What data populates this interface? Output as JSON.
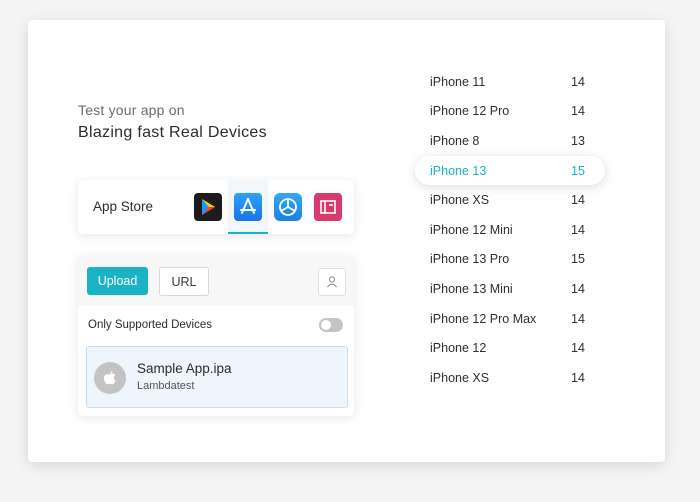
{
  "intro": {
    "line1": "Test your app on",
    "line2": "Blazing fast Real Devices"
  },
  "store_bar": {
    "label": "App Store",
    "icons": [
      "google-play-icon",
      "app-store-icon",
      "testflight-icon",
      "app-center-icon"
    ],
    "active_index": 1
  },
  "upload_panel": {
    "upload_label": "Upload",
    "url_label": "URL",
    "user_icon": "user-icon",
    "supported_label": "Only Supported Devices",
    "supported_toggle_on": false,
    "file": {
      "name": "Sample App.ipa",
      "subtitle": "Lambdatest",
      "icon": "apple-icon"
    }
  },
  "devices": [
    {
      "name": "iPhone 11",
      "version": "14"
    },
    {
      "name": "iPhone 12 Pro",
      "version": "14"
    },
    {
      "name": "iPhone 8",
      "version": "13"
    },
    {
      "name": "iPhone 13",
      "version": "15"
    },
    {
      "name": "iPhone XS",
      "version": "14"
    },
    {
      "name": "iPhone 12 Mini",
      "version": "14"
    },
    {
      "name": "iPhone 13 Pro",
      "version": "15"
    },
    {
      "name": "iPhone 13 Mini",
      "version": "14"
    },
    {
      "name": "iPhone 12 Pro Max",
      "version": "14"
    },
    {
      "name": "iPhone 12",
      "version": "14"
    },
    {
      "name": "iPhone XS",
      "version": "14"
    }
  ],
  "selected_device_index": 3,
  "colors": {
    "accent": "#15b2c8",
    "upload_button": "#1ab3c6",
    "file_card_bg": "#eef5fc"
  }
}
